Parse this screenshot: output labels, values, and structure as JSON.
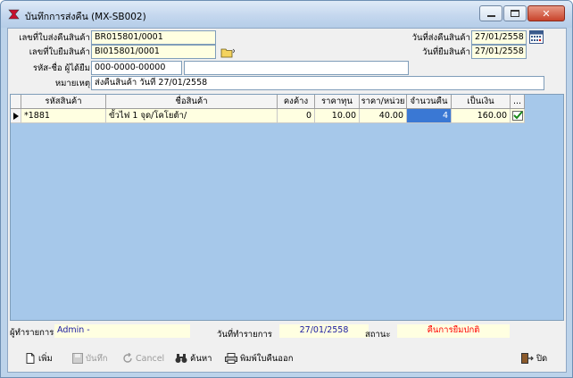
{
  "window": {
    "title": "บันทึกการส่งคืน (MX-SB002)"
  },
  "header": {
    "return_no": {
      "label": "เลขที่ใบส่งคืนสินค้า",
      "value": "BR015801/0001"
    },
    "borrow_no": {
      "label": "เลขที่ใบยืมสินค้า",
      "value": "BI015801/0001"
    },
    "borrower": {
      "label": "รหัส-ชื่อ ผู้ได้ยืม",
      "code": "000-0000-00000",
      "name": ""
    },
    "note": {
      "label": "หมายเหตุ",
      "value": "ส่งคืนสินค้า วันที่ 27/01/2558"
    },
    "return_date": {
      "label": "วันที่ส่งคืนสินค้า",
      "value": "27/01/2558"
    },
    "borrow_date": {
      "label": "วันที่ยืมสินค้า",
      "value": "27/01/2558"
    }
  },
  "grid": {
    "columns": [
      "รหัสสินค้า",
      "ชื่อสินค้า",
      "คงค้าง",
      "ราคาทุน",
      "ราคา/หน่วย",
      "จำนวนคืน",
      "เป็นเงิน",
      "..."
    ],
    "rows": [
      {
        "code": "*1881",
        "name": "ขั้วไฟ 1 จุด/โคโยต้า/",
        "remaining": "0",
        "cost": "10.00",
        "unit_price": "40.00",
        "return_qty": "4",
        "amount": "160.00",
        "checked": true
      }
    ]
  },
  "status": {
    "operator_label": "ผู้ทำรายการ",
    "operator_value": "Admin -",
    "date_label": "วันที่ทำรายการ",
    "date_value": "27/01/2558",
    "state_label": "สถานะ",
    "state_value": "คืนการยืมปกติ",
    "state_color": "#ff0000",
    "value_color": "#1a1aa0"
  },
  "toolbar": {
    "add": "เพิ่ม",
    "save": "บันทึก",
    "cancel": "Cancel",
    "search": "ค้นหา",
    "print": "พิมพ์ใบคืนออก",
    "close": "ปิด"
  },
  "icons": [
    "app-icon",
    "calendar-icon",
    "folder-icon",
    "row-pointer-icon",
    "check-icon",
    "new-doc-icon",
    "save-icon",
    "cancel-icon",
    "binoculars-icon",
    "printer-icon",
    "exit-icon"
  ]
}
